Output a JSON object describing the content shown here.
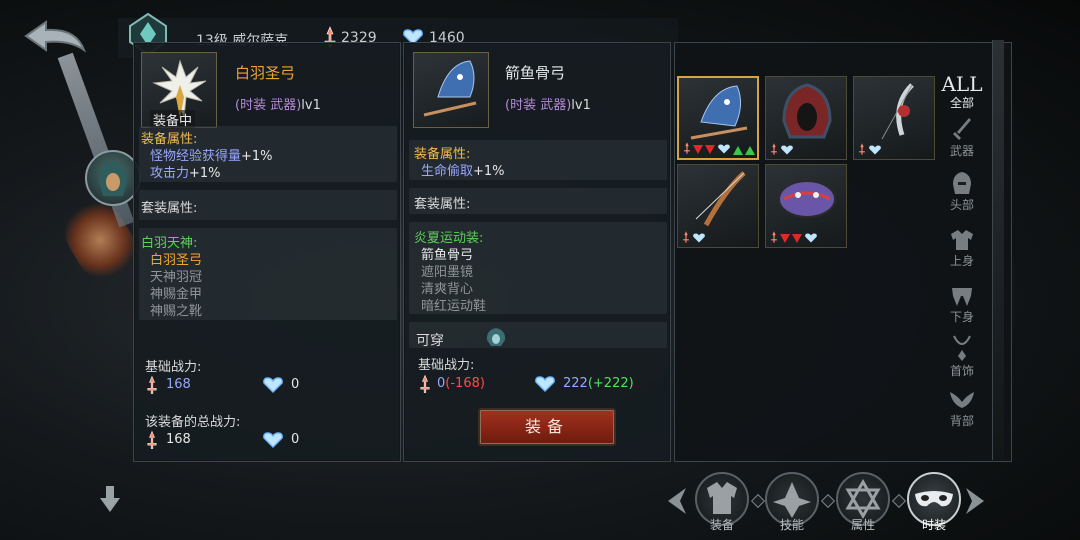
{
  "header": {
    "level_name": "13级 威尔萨克",
    "attack_power": "2329",
    "defense_power": "1460"
  },
  "left_panel": {
    "equipped_tag": "装备中",
    "item_name": "白羽圣弓",
    "item_type": "(时装 武器)",
    "item_level": "lv1",
    "attr_title": "装备属性:",
    "attrs": [
      {
        "label": "怪物经验获得量",
        "value": "+1%"
      },
      {
        "label": "攻击力",
        "value": "+1%"
      }
    ],
    "set_attr_title": "套装属性:",
    "set_name": "白羽天神:",
    "set_items": [
      "白羽圣弓",
      "天神羽冠",
      "神赐金甲",
      "神赐之靴"
    ],
    "base_power_label": "基础战力:",
    "base_attack": "168",
    "base_defense": "0",
    "total_power_label": "该装备的总战力:",
    "total_attack": "168",
    "total_defense": "0"
  },
  "mid_panel": {
    "item_name": "箭鱼骨弓",
    "item_type": "(时装 武器)",
    "item_level": "lv1",
    "attr_title": "装备属性:",
    "attrs": [
      {
        "label": "生命偷取",
        "value": "+1%"
      }
    ],
    "set_attr_title": "套装属性:",
    "set_name": "炎夏运动装:",
    "set_items": [
      "箭鱼骨弓",
      "遮阳墨镜",
      "清爽背心",
      "暗红运动鞋"
    ],
    "wearable_label": "可穿",
    "base_power_label": "基础战力:",
    "base_attack": "0",
    "attack_delta": "(-168)",
    "base_defense": "222",
    "defense_delta": "(+222)",
    "equip_button": "装备"
  },
  "categories": {
    "all_big": "ALL",
    "all_small": "全部",
    "items": [
      "武器",
      "头部",
      "上身",
      "下身",
      "首饰",
      "背部"
    ]
  },
  "tabs": [
    "装备",
    "技能",
    "属性",
    "时装"
  ],
  "colors": {
    "attr_blue": "#9aa6ff",
    "section_gold": "#f2bb4c",
    "set_green": "#4ee35c",
    "active_orange": "#f0a530",
    "delta_red": "#ff4a4a",
    "delta_green": "#4ee35c",
    "button_red": "#a3311e"
  },
  "icons": {
    "attack": "red-sword-icon",
    "defense": "blue-heart-shield-icon",
    "back": "back-arrow-icon",
    "scroll_down": "down-arrow-icon"
  }
}
